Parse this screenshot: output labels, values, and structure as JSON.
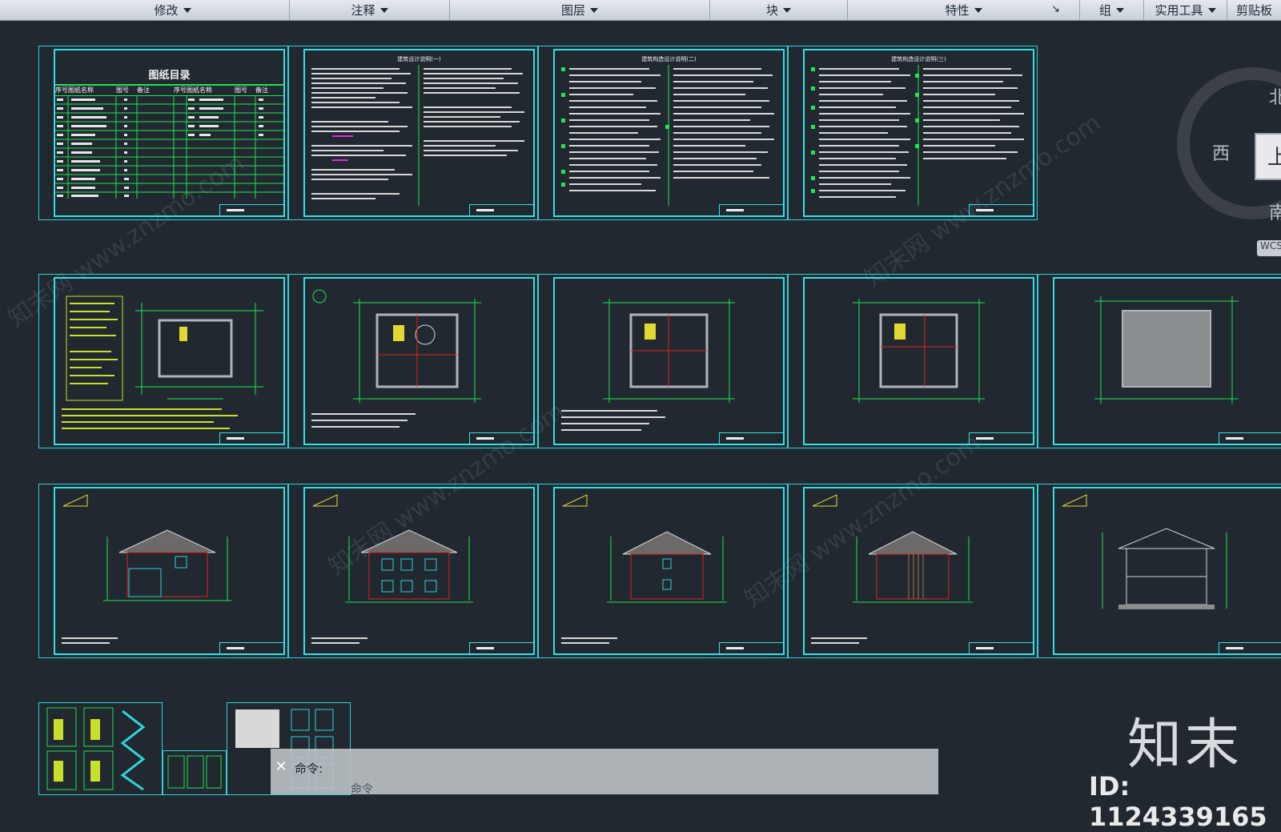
{
  "ribbon": {
    "panels": [
      "修改",
      "注释",
      "图层",
      "块",
      "特性",
      "组",
      "实用工具",
      "剪贴板"
    ]
  },
  "sheets": {
    "index_title": "图纸目录",
    "index_headers": [
      "序号",
      "图纸名称",
      "图号",
      "备注",
      "序号",
      "图纸名称",
      "图号",
      "备注"
    ],
    "notes_titles": [
      "建筑设计说明(一)",
      "建筑构造设计说明(二)",
      "建筑构造设计说明(三)"
    ]
  },
  "viewcube": {
    "north": "北",
    "west": "西",
    "south": "南",
    "face": "上",
    "wcs": "WCS"
  },
  "command": {
    "label": "命令:",
    "history": "命令"
  },
  "watermark": {
    "logo": "知末",
    "id": "ID: 1124339165"
  },
  "colors": {
    "background": "#212830",
    "sheet_border": "#34e0e6",
    "drawing_green": "#1ee84a",
    "ribbon": "#d6dbe2"
  }
}
